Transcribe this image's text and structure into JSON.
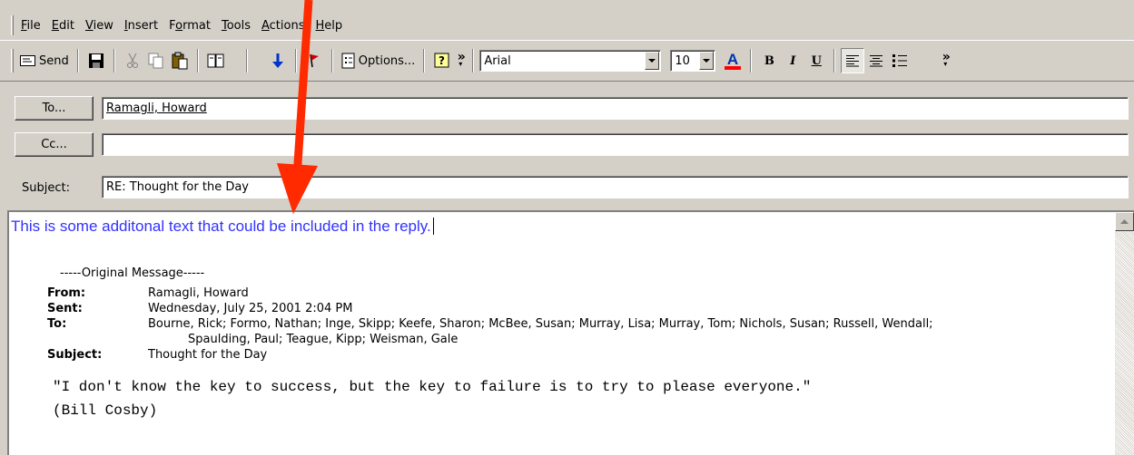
{
  "menu": [
    "File",
    "Edit",
    "View",
    "Insert",
    "Format",
    "Tools",
    "Actions",
    "Help"
  ],
  "menu_underline_index": [
    0,
    0,
    0,
    0,
    1,
    0,
    0,
    0
  ],
  "toolbar": {
    "send_label": "Send",
    "options_label": "Options...",
    "font_name": "Arial",
    "font_size": "10",
    "font_color": "#ff0000"
  },
  "header": {
    "to_button": "To...",
    "cc_button": "Cc...",
    "subject_label": "Subject:",
    "to_value": "Ramagli, Howard",
    "cc_value": "",
    "subject_value": "RE: Thought for the Day"
  },
  "body": {
    "reply_text": "This is some additonal text that could be included in the reply.",
    "original_separator": "-----Original Message-----",
    "from_label": "From:",
    "from_value": "Ramagli, Howard",
    "sent_label": "Sent:",
    "sent_value": "Wednesday, July 25, 2001 2:04 PM",
    "to_label": "To:",
    "to_value_line1": "Bourne, Rick; Formo, Nathan; Inge, Skipp; Keefe, Sharon; McBee, Susan; Murray, Lisa; Murray, Tom; Nichols, Susan; Russell, Wendall;",
    "to_value_line2": "Spaulding, Paul; Teague, Kipp; Weisman, Gale",
    "subject_label": "Subject:",
    "subject_value": "Thought for the Day",
    "quote_line1": "\"I don't know the key to success, but the key to failure is to try to please everyone.\"",
    "quote_line2": "(Bill Cosby)"
  },
  "colors": {
    "reply_text": "#3232ff",
    "annotation_arrow": "#ff2a00"
  }
}
